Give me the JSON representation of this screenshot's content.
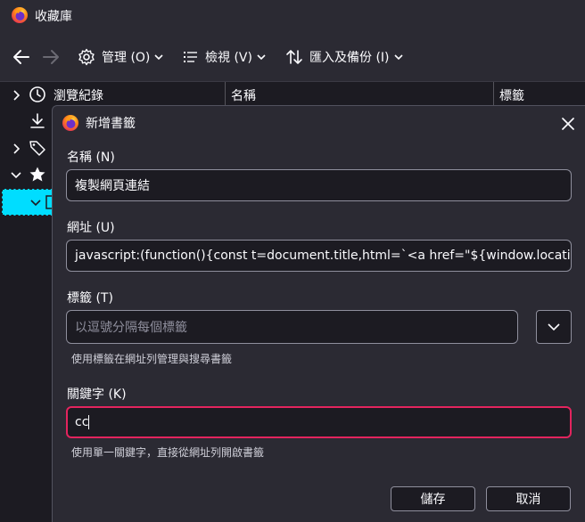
{
  "window": {
    "title": "收藏庫"
  },
  "toolbar": {
    "manage_label": "管理 (O)",
    "view_label": "檢視 (V)",
    "import_backup_label": "匯入及備份 (I)"
  },
  "sidebar": {
    "history_label": "瀏覽紀錄"
  },
  "columns": {
    "name": "名稱",
    "tags": "標籤"
  },
  "dialog": {
    "title": "新增書籤",
    "name_label": "名稱 (N)",
    "name_value": "複製網頁連結",
    "url_label": "網址 (U)",
    "url_value": "javascript:(function(){const t=document.title,html=`<a href=\"${window.location.",
    "tags_label": "標籤 (T)",
    "tags_placeholder": "以逗號分隔每個標籤",
    "tags_hint": "使用標籤在網址列管理與搜尋書籤",
    "keyword_label": "關鍵字 (K)",
    "keyword_value": "cc",
    "keyword_hint": "使用單一關鍵字，直接從網址列開啟書籤",
    "save_label": "儲存",
    "cancel_label": "取消"
  },
  "colors": {
    "focus_border": "#e3245e",
    "selection": "#00ddff"
  }
}
